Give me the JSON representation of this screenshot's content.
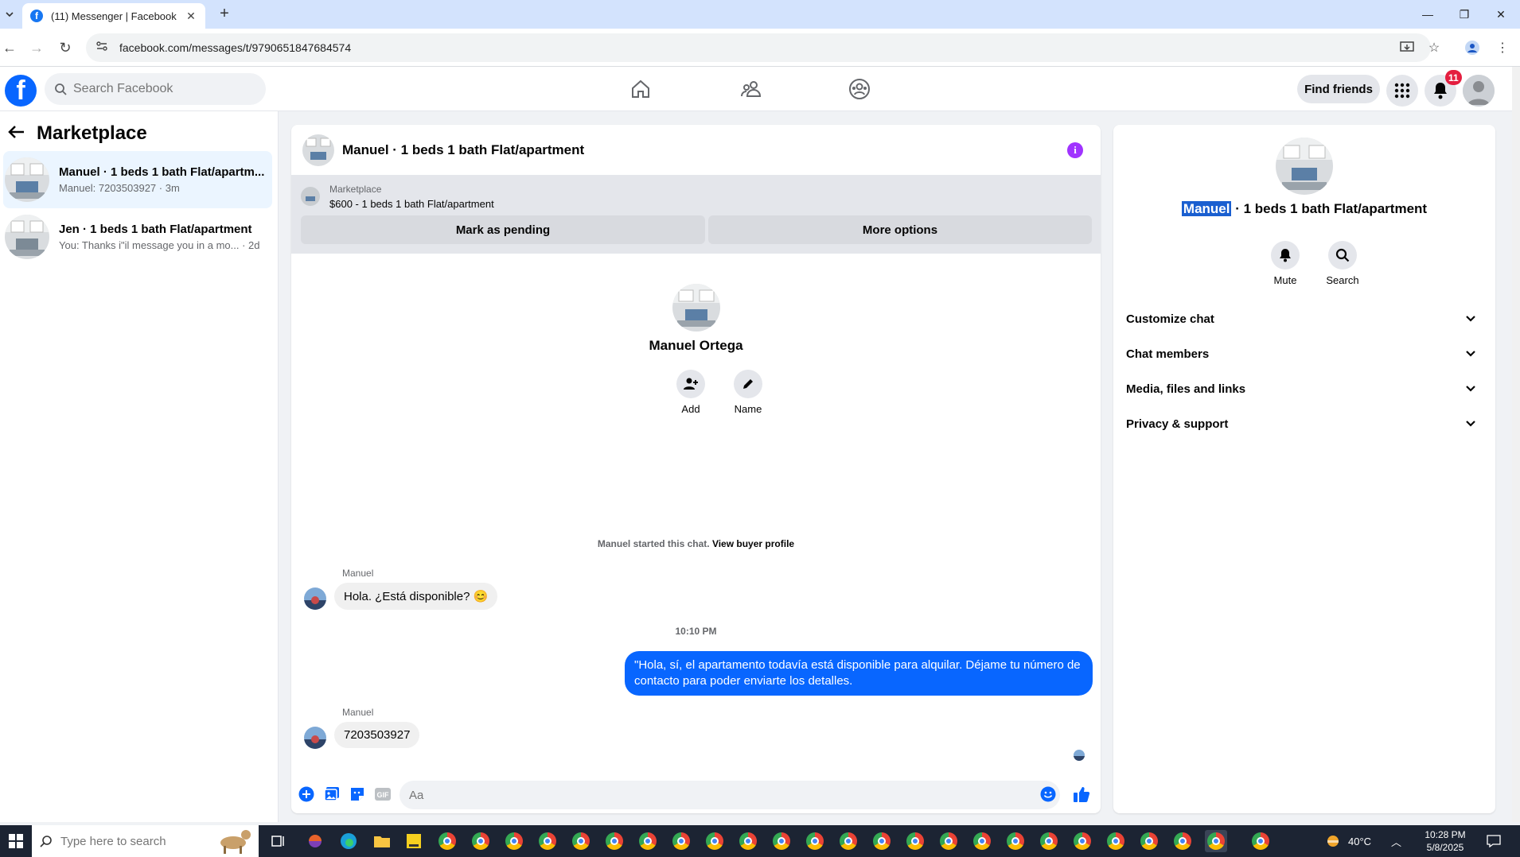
{
  "browser": {
    "tab_title": "(11) Messenger | Facebook",
    "url": "facebook.com/messages/t/9790651847684574"
  },
  "fb": {
    "search_placeholder": "Search Facebook",
    "find_friends": "Find friends",
    "notification_count": "11"
  },
  "sidebar": {
    "title": "Marketplace",
    "conversations": [
      {
        "name": "Manuel · 1 beds 1 bath Flat/apartm...",
        "sub": "Manuel: 7203503927 · 3m",
        "active": true
      },
      {
        "name": "Jen · 1 beds 1 bath Flat/apartment",
        "sub": "You: Thanks i\"il message you in a mo... · 2d",
        "active": false
      }
    ]
  },
  "chat": {
    "title": "Manuel · 1 beds 1 bath Flat/apartment",
    "marketplace_label": "Marketplace",
    "listing": "$600 - 1 beds 1 bath Flat/apartment",
    "mark_pending": "Mark as pending",
    "more_options": "More options",
    "profile_name": "Manuel Ortega",
    "add_label": "Add",
    "name_label": "Name",
    "started_text": "Manuel started this chat.",
    "view_profile": "View buyer profile",
    "messages": [
      {
        "sender": "Manuel",
        "text": "Hola. ¿Está disponible? 😊"
      },
      {
        "timestamp": "10:10 PM"
      },
      {
        "text": "\"Hola, sí, el apartamento todavía está disponible para alquilar. Déjame tu número de contacto para poder enviarte los detalles."
      },
      {
        "sender": "Manuel",
        "text": "7203503927"
      }
    ],
    "composer_placeholder": "Aa"
  },
  "details": {
    "title_highlight": "Manuel",
    "title_rest": " · 1 beds 1 bath Flat/apartment",
    "mute": "Mute",
    "search": "Search",
    "sections": [
      "Customize chat",
      "Chat members",
      "Media, files and links",
      "Privacy & support"
    ]
  },
  "taskbar": {
    "search_placeholder": "Type here to search",
    "temperature": "40°C",
    "time": "10:28 PM",
    "date": "5/8/2025"
  }
}
